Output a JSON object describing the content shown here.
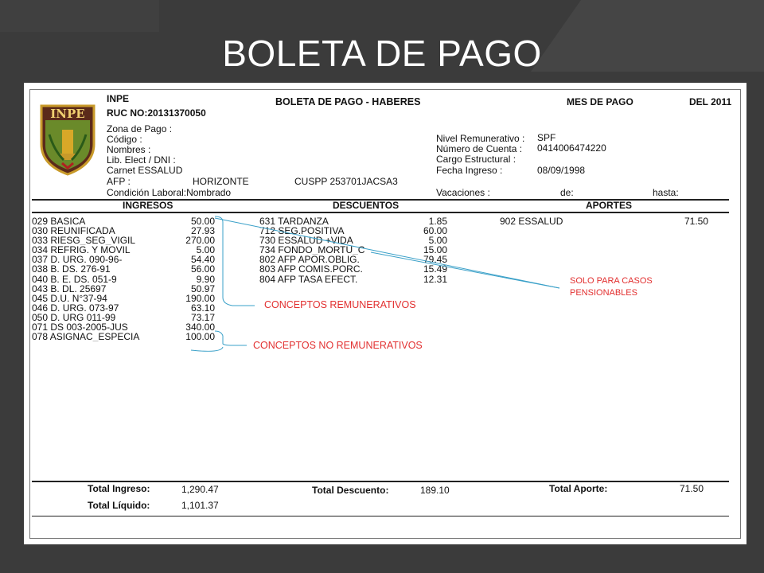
{
  "slide": {
    "title": "BOLETA DE PAGO",
    "colors": {
      "background": "#3b3b3b",
      "annotation": "#e23030",
      "arrow": "#3aa0c8"
    }
  },
  "header": {
    "org": "INPE",
    "ruc": "RUC NO:20131370050",
    "doc_title": "BOLETA DE PAGO - HABERES",
    "mes_label": "MES DE PAGO",
    "year_label": "DEL 2011"
  },
  "logo": {
    "text": "INPE",
    "icon": "inpe-shield-logo"
  },
  "fields_left": {
    "zona": "Zona de Pago :",
    "codigo": "Código :",
    "nombres": "Nombres :",
    "lib": "Lib. Elect / DNI :",
    "carnet": "Carnet ESSALUD",
    "afp_label": "AFP :",
    "afp_value": "HORIZONTE",
    "cuspp": "CUSPP 253701JACSA3",
    "condicion": "Condición Laboral:Nombrado"
  },
  "fields_right": {
    "nivel_label": "Nivel Remunerativo :",
    "nivel_value": "SPF",
    "cuenta_label": "Número de Cuenta :",
    "cuenta_value": "0414006474220",
    "cargo_label": "Cargo Estructural :",
    "fecha_label": "Fecha Ingreso :",
    "fecha_value": "08/09/1998",
    "vacaciones": "Vacaciones :",
    "de": "de:",
    "hasta": "hasta:"
  },
  "sections": {
    "ingresos": "INGRESOS",
    "descuentos": "DESCUENTOS",
    "aportes": "APORTES"
  },
  "ingresos": [
    {
      "label": "029 BASICA",
      "amount": "50.00"
    },
    {
      "label": "030 REUNIFICADA",
      "amount": "27.93"
    },
    {
      "label": "033 RIESG_SEG_VIGIL",
      "amount": "270.00"
    },
    {
      "label": "034 REFRIG. Y MOVIL",
      "amount": "5.00"
    },
    {
      "label": "037 D. URG. 090-96-",
      "amount": "54.40"
    },
    {
      "label": "038 B. DS. 276-91",
      "amount": "56.00"
    },
    {
      "label": "040 B. E. DS. 051-9",
      "amount": "9.90"
    },
    {
      "label": "043 B. DL. 25697",
      "amount": "50.97"
    },
    {
      "label": "045 D.U. N°37-94",
      "amount": "190.00"
    },
    {
      "label": "046 D. URG. 073-97",
      "amount": "63.10"
    },
    {
      "label": "050 D. URG 011-99",
      "amount": "73.17"
    },
    {
      "label": "071 DS 003-2005-JUS",
      "amount": "340.00"
    },
    {
      "label": "078 ASIGNAC_ESPECIA",
      "amount": "100.00"
    }
  ],
  "descuentos": [
    {
      "label": "631 TARDANZA",
      "amount": "1.85"
    },
    {
      "label": "712 SEG.POSITIVA",
      "amount": "60.00"
    },
    {
      "label": "730 ESSALUD +VIDA",
      "amount": "5.00"
    },
    {
      "label": "734 FONDO_MORTU_C",
      "amount": "15.00"
    },
    {
      "label": "802 AFP APOR.OBLIG.",
      "amount": "79.45"
    },
    {
      "label": "803 AFP COMIS.PORC.",
      "amount": "15.49"
    },
    {
      "label": "804 AFP TASA EFECT.",
      "amount": "12.31"
    }
  ],
  "aportes": [
    {
      "label": "902 ESSALUD",
      "amount": "71.50"
    }
  ],
  "annotations": {
    "remunerativos": "CONCEPTOS REMUNERATIVOS",
    "no_remunerativos": "CONCEPTOS  NO REMUNERATIVOS",
    "pensionables_1": "SOLO PARA CASOS",
    "pensionables_2": "PENSIONABLES"
  },
  "totals": {
    "ingreso_label": "Total Ingreso:",
    "ingreso_value": "1,290.47",
    "liquido_label": "Total Líquido:",
    "liquido_value": "1,101.37",
    "descuento_label": "Total Descuento:",
    "descuento_value": "189.10",
    "aporte_label": "Total Aporte:",
    "aporte_value": "71.50"
  }
}
